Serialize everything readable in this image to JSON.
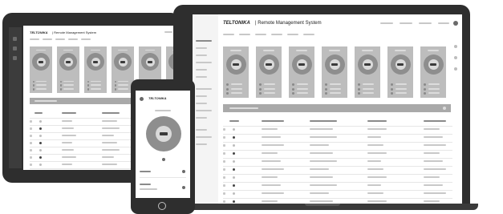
{
  "brand": {
    "logo_text": "TELTONIKA",
    "separator": "|",
    "product_name": "Remote Management System"
  },
  "colors": {
    "device_frame": "#2e2e2e",
    "device_bezel": "#4a4a4a",
    "screen": "#ffffff",
    "card": "#bdbdbd",
    "donut_ring": "#8e8e8e",
    "section_bar": "#a9a9a9"
  },
  "devices": {
    "laptop_label": "laptop",
    "tablet_label": "tablet",
    "phone_label": "phone"
  }
}
